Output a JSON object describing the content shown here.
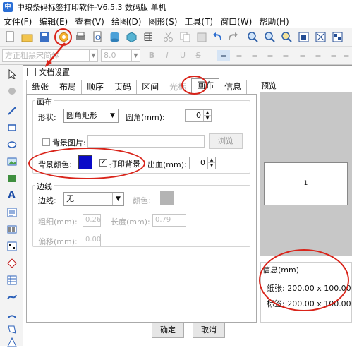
{
  "app": {
    "title": "中琅条码标签打印软件-V6.5.3 数码版 单机",
    "icon": "中"
  },
  "menu": [
    "文件(F)",
    "编辑(E)",
    "查看(V)",
    "绘图(D)",
    "图形(S)",
    "工具(T)",
    "窗口(W)",
    "帮助(H)"
  ],
  "fontbar": {
    "font": "方正粗黑宋简体",
    "size": "8.0"
  },
  "dialog": {
    "title": "文档设置",
    "tabs": [
      "纸张",
      "布局",
      "顺序",
      "页码",
      "区间",
      "光标",
      "画布",
      "信息"
    ],
    "active_tab": "画布",
    "canvas": {
      "group_label": "画布",
      "shape_label": "形状:",
      "shape_value": "圆角矩形",
      "corner_label": "圆角(mm):",
      "corner_value": "0",
      "bg_image_label": "背景图片:",
      "browse_label": "浏览",
      "bg_color_label": "背景颜色:",
      "bg_color": "#0a0ac8",
      "print_bg_label": "打印背景",
      "print_bg_checked": "✔",
      "bleed_label": "出血(mm):",
      "bleed_value": "0"
    },
    "border": {
      "group_label": "边线",
      "line_label": "边线:",
      "line_value": "无",
      "color_label": "颜色:",
      "color": "#b4b4b4",
      "width_label": "粗细(mm):",
      "width_value": "0.26",
      "length_label": "长度(mm):",
      "length_value": "0.79",
      "offset_label": "偏移(mm):",
      "offset_value": "0.00"
    },
    "ok_label": "确定",
    "cancel_label": "取消"
  },
  "preview": {
    "title": "预览",
    "label_text": "1",
    "info_title": "信息(mm)",
    "paper_line": "纸张: 200.00 x 100.00",
    "label_line": "标签: 200.00 x 100.00"
  }
}
